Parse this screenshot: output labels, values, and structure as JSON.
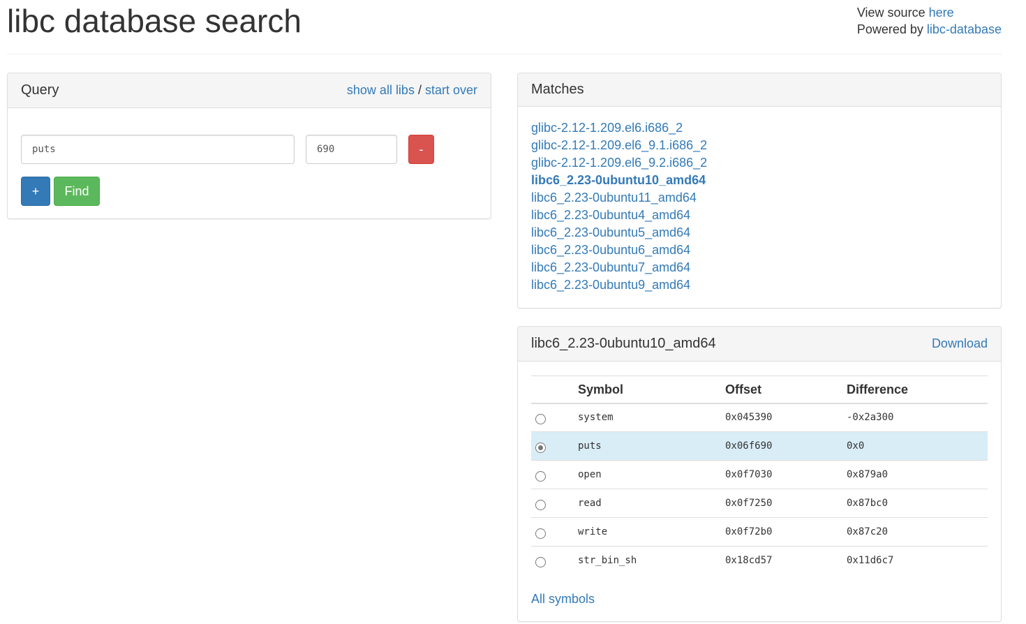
{
  "header": {
    "title": "libc database search",
    "view_source_prefix": "View source ",
    "view_source_link": "here",
    "powered_by_prefix": "Powered by ",
    "powered_by_link": "libc-database"
  },
  "query": {
    "title": "Query",
    "show_all_libs": "show all libs",
    "separator": " / ",
    "start_over": "start over",
    "symbol_value": "puts",
    "offset_value": "690",
    "remove_label": "-",
    "add_label": "+",
    "find_label": "Find"
  },
  "matches": {
    "title": "Matches",
    "items": [
      "glibc-2.12-1.209.el6.i686_2",
      "glibc-2.12-1.209.el6_9.1.i686_2",
      "glibc-2.12-1.209.el6_9.2.i686_2",
      "libc6_2.23-0ubuntu10_amd64",
      "libc6_2.23-0ubuntu11_amd64",
      "libc6_2.23-0ubuntu4_amd64",
      "libc6_2.23-0ubuntu5_amd64",
      "libc6_2.23-0ubuntu6_amd64",
      "libc6_2.23-0ubuntu7_amd64",
      "libc6_2.23-0ubuntu9_amd64"
    ],
    "active_index": 3
  },
  "lib": {
    "title": "libc6_2.23-0ubuntu10_amd64",
    "download": "Download",
    "columns": [
      "Symbol",
      "Offset",
      "Difference"
    ],
    "rows": [
      {
        "symbol": "system",
        "offset": "0x045390",
        "difference": "-0x2a300",
        "selected": false
      },
      {
        "symbol": "puts",
        "offset": "0x06f690",
        "difference": "0x0",
        "selected": true
      },
      {
        "symbol": "open",
        "offset": "0x0f7030",
        "difference": "0x879a0",
        "selected": false
      },
      {
        "symbol": "read",
        "offset": "0x0f7250",
        "difference": "0x87bc0",
        "selected": false
      },
      {
        "symbol": "write",
        "offset": "0x0f72b0",
        "difference": "0x87c20",
        "selected": false
      },
      {
        "symbol": "str_bin_sh",
        "offset": "0x18cd57",
        "difference": "0x11d6c7",
        "selected": false
      }
    ],
    "all_symbols": "All symbols"
  }
}
